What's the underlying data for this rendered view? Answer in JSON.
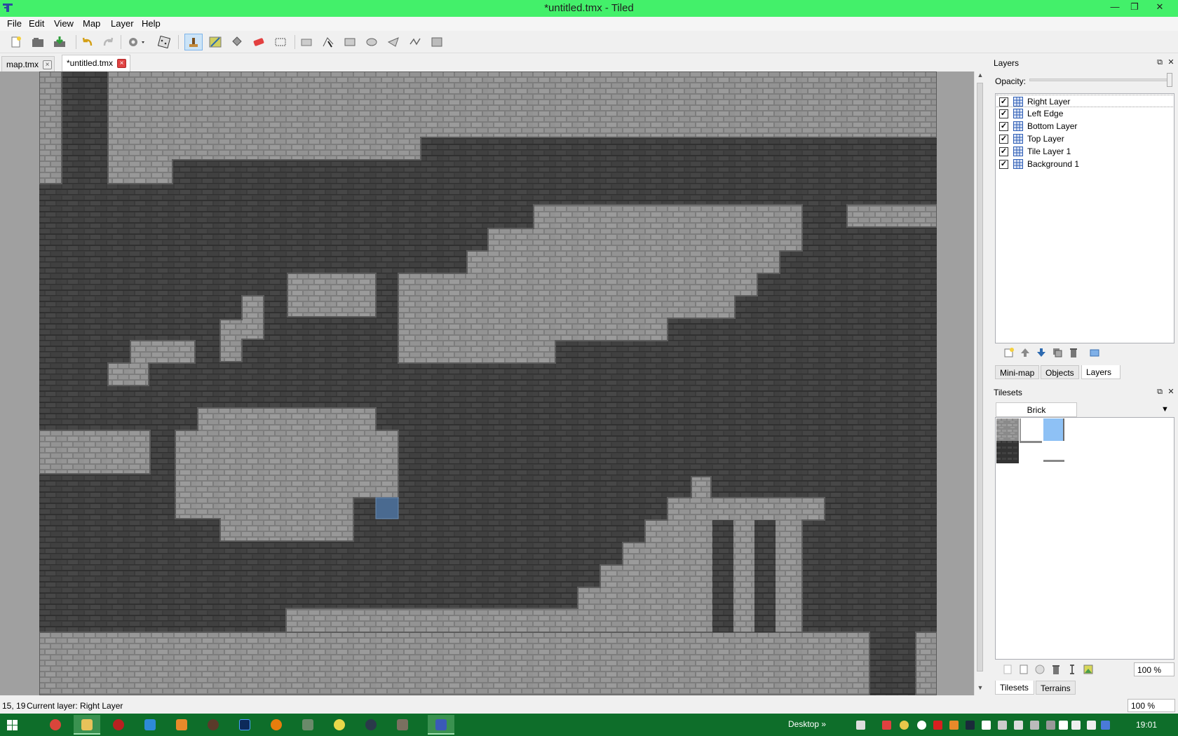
{
  "window": {
    "title": "*untitled.tmx - Tiled",
    "minimize": "—",
    "restore": "❐",
    "close": "✕"
  },
  "menu": [
    "File",
    "Edit",
    "View",
    "Map",
    "Layer",
    "Help"
  ],
  "toolbar": [
    "new-file-icon",
    "open-file-icon",
    "save-file-icon",
    "undo-icon",
    "redo-icon",
    "command-icon",
    "random-mode-icon",
    "stamp-brush-icon",
    "terrain-brush-icon",
    "bucket-fill-icon",
    "eraser-icon",
    "rectangle-select-icon",
    "select-objects-icon",
    "edit-polygons-icon",
    "insert-rectangle-icon",
    "insert-ellipse-icon",
    "insert-polygon-icon",
    "insert-polyline-icon",
    "insert-tile-icon"
  ],
  "tabs": [
    {
      "label": "map.tmx",
      "close": "×"
    },
    {
      "label": "*untitled.tmx",
      "close": "×"
    }
  ],
  "status": {
    "coords": "15, 19",
    "layer": "Current layer: Right Layer",
    "zoom": "100 %"
  },
  "layers_panel": {
    "title": "Layers",
    "opacity_label": "Opacity:",
    "opacity_value": 1.0,
    "layers": [
      {
        "name": "Right Layer",
        "visible": true,
        "selected": true
      },
      {
        "name": "Left Edge",
        "visible": true,
        "selected": false
      },
      {
        "name": "Bottom Layer",
        "visible": true,
        "selected": false
      },
      {
        "name": "Top Layer",
        "visible": true,
        "selected": false
      },
      {
        "name": "Tile Layer 1",
        "visible": true,
        "selected": false
      },
      {
        "name": "Background 1",
        "visible": true,
        "selected": false
      }
    ],
    "check_mark": "✓",
    "tools": [
      "add-layer-icon",
      "raise-layer-icon",
      "lower-layer-icon",
      "duplicate-layer-icon",
      "remove-layer-icon",
      "show-hide-others-icon"
    ],
    "dock_tabs": [
      "Mini-map",
      "Objects",
      "Layers"
    ]
  },
  "tilesets_panel": {
    "title": "Tilesets",
    "tileset_name": "Brick",
    "menu_arrow": "▼",
    "zoom": "100 %",
    "dock_tabs": [
      "Tilesets",
      "Terrains"
    ]
  },
  "taskbar": {
    "desktop_label": "Desktop",
    "chevron": "»",
    "time": "19:01"
  },
  "colors": {
    "titlebar": "#43f06a",
    "taskbar": "#0e6e2a",
    "dark_brick": "#3a3a3a",
    "light_brick": "#8f8f8f",
    "selection": "#4a6a90"
  }
}
